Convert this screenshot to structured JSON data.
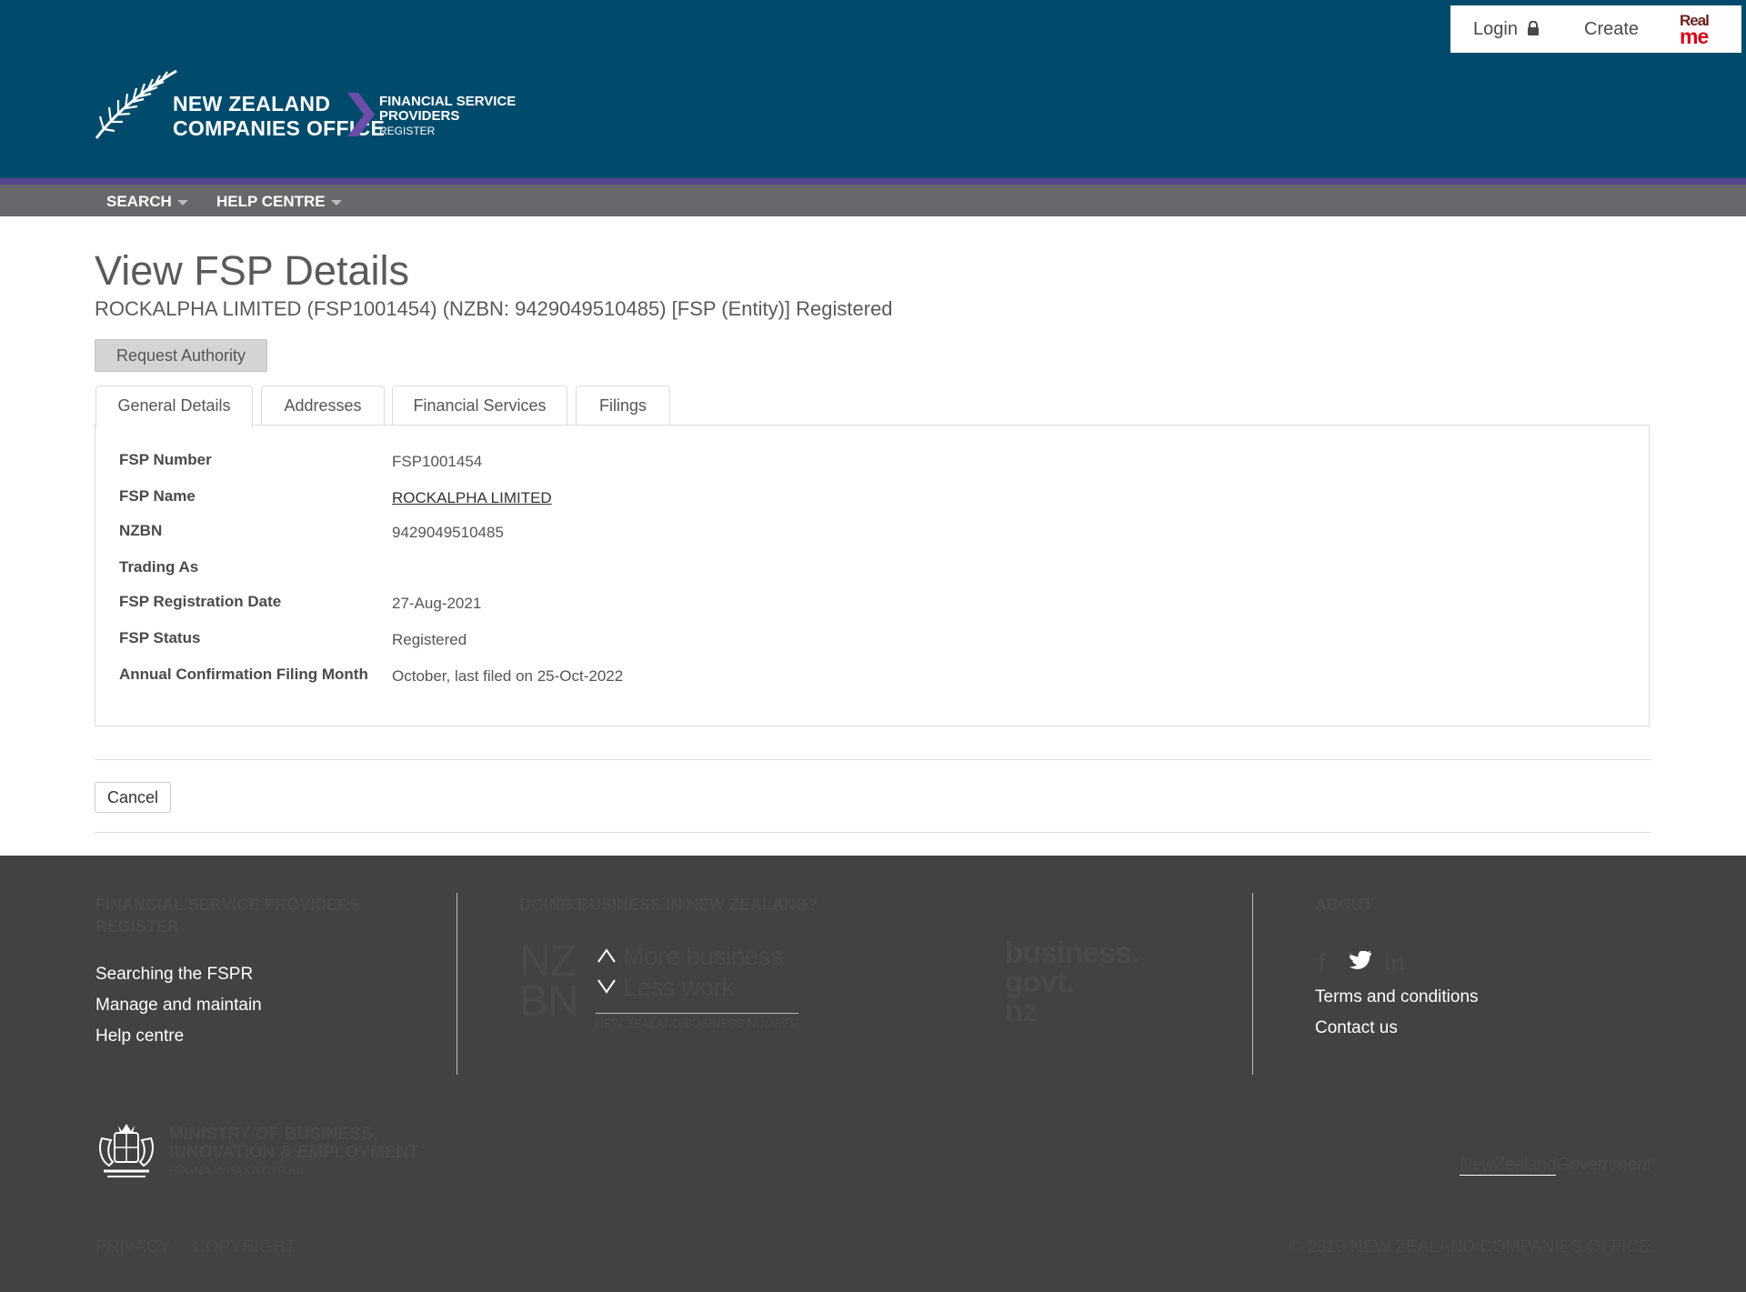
{
  "header": {
    "brand_line1": "NEW ZEALAND",
    "brand_line2": "COMPANIES OFFICE",
    "register_line1": "FINANCIAL SERVICE",
    "register_line2": "PROVIDERS",
    "register_line3": "REGISTER",
    "login_label": "Login",
    "create_label": "Create",
    "realme_line1": "Real",
    "realme_line2": "me"
  },
  "nav": {
    "items": [
      {
        "label": "SEARCH"
      },
      {
        "label": "HELP CENTRE"
      }
    ]
  },
  "page": {
    "title": "View FSP Details",
    "subtitle": "ROCKALPHA LIMITED (FSP1001454) (NZBN: 9429049510485) [FSP (Entity)] Registered",
    "request_button": "Request Authority"
  },
  "tabs": [
    {
      "label": "General Details",
      "active": true
    },
    {
      "label": "Addresses"
    },
    {
      "label": "Financial Services"
    },
    {
      "label": "Filings"
    }
  ],
  "details": [
    {
      "label": "FSP Number",
      "value": "FSP1001454"
    },
    {
      "label": "FSP Name",
      "value": "ROCKALPHA LIMITED"
    },
    {
      "label": "NZBN",
      "value": "9429049510485"
    },
    {
      "label": "Trading As",
      "value": ""
    },
    {
      "label": "FSP Registration Date",
      "value": "27-Aug-2021"
    },
    {
      "label": "FSP Status",
      "value": "Registered"
    },
    {
      "label": "Annual Confirmation Filing Month",
      "value": "October, last filed on 25-Oct-2022"
    }
  ],
  "actions": {
    "cancel_label": "Cancel"
  },
  "footer": {
    "col1_title_line1": "FINANCIAL SERVICE PROVIDERS",
    "col1_title_line2": "REGISTER",
    "col1_links": [
      "Searching the FSPR",
      "Manage and maintain",
      "Help centre"
    ],
    "col2_title": "DOING BUSINESS IN NEW ZEALAND?",
    "nzbn": {
      "nz": "NZ",
      "bn": "BN",
      "line1": "More business",
      "line2": "Less work",
      "small": "NEW ZEALAND BUSINESS NUMBER"
    },
    "bgn": {
      "line1": "business.",
      "line2": "govt.",
      "line3": "nz"
    },
    "col3_title": "ABOUT",
    "social": [
      "f",
      "in"
    ],
    "col3_links": [
      "Terms and conditions",
      "Contact us"
    ],
    "mbie": {
      "line1": "MINISTRY OF BUSINESS,",
      "line2": "INNOVATION & EMPLOYMENT",
      "line3": "HĪKINA WHAKATUTUKI"
    },
    "nzgov": {
      "part1": "New",
      "part2": "Zealand",
      "part3": "Government"
    },
    "bottom_links": [
      "PRIVACY",
      "COPYRIGHT"
    ],
    "copyright": "© 2019 NEW ZEALAND COMPANIES OFFICE"
  }
}
